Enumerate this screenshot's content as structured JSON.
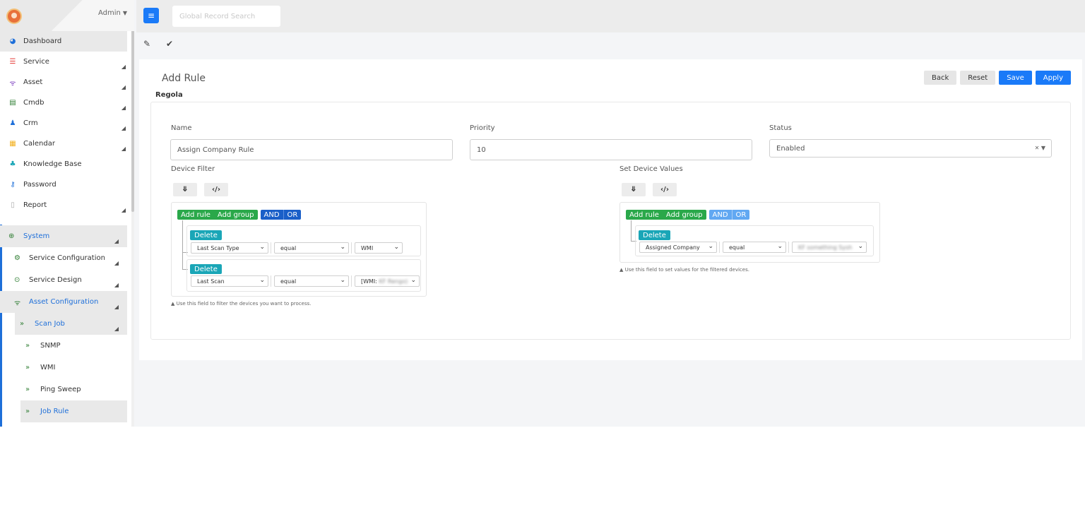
{
  "sidebar": {
    "user_label": "Admin",
    "items": [
      {
        "label": "Dashboard",
        "icon": "dashboard-icon",
        "color": "#1e6fd9"
      },
      {
        "label": "Service",
        "icon": "list-icon",
        "color": "#e53935"
      },
      {
        "label": "Asset",
        "icon": "wifi-icon",
        "color": "#7b3fbf"
      },
      {
        "label": "Cmdb",
        "icon": "database-icon",
        "color": "#2e7d32"
      },
      {
        "label": "Crm",
        "icon": "user-icon",
        "color": "#1e6fd9"
      },
      {
        "label": "Calendar",
        "icon": "calendar-icon",
        "color": "#f2b01e"
      },
      {
        "label": "Knowledge Base",
        "icon": "knowledge-icon",
        "color": "#1aa6b7"
      },
      {
        "label": "Password",
        "icon": "key-icon",
        "color": "#1e6fd9"
      },
      {
        "label": "Report",
        "icon": "file-icon",
        "color": "#999999"
      }
    ],
    "system": {
      "label": "System",
      "icon": "globe-icon",
      "color": "#2e7d32"
    },
    "system_children": [
      {
        "label": "Service Configuration",
        "icon": "cogs-icon",
        "color": "#2e7d32"
      },
      {
        "label": "Service Design",
        "icon": "target-icon",
        "color": "#2e7d32"
      },
      {
        "label": "Asset Configuration",
        "icon": "wifi-icon",
        "color": "#2e7d32"
      }
    ],
    "scan_job": {
      "label": "Scan Job"
    },
    "scan_children": [
      {
        "label": "SNMP"
      },
      {
        "label": "WMI"
      },
      {
        "label": "Ping Sweep"
      },
      {
        "label": "Job Rule"
      }
    ]
  },
  "topbar": {
    "menu_icon": "≡",
    "search_placeholder": "Global Record Search"
  },
  "page": {
    "title": "Add Rule",
    "subtitle": "Regola",
    "actions": {
      "back": "Back",
      "reset": "Reset",
      "save": "Save",
      "apply": "Apply"
    }
  },
  "form": {
    "name_label": "Name",
    "name_value": "Assign Company Rule",
    "priority_label": "Priority",
    "priority_value": "10",
    "status_label": "Status",
    "status_value": "Enabled",
    "device_filter_label": "Device Filter",
    "set_values_label": "Set Device Values"
  },
  "query_builder": {
    "add_rule": "Add rule",
    "add_group": "Add group",
    "and": "AND",
    "or": "OR",
    "delete": "Delete"
  },
  "filter_rules": [
    {
      "field": "Last Scan Type",
      "operator": "equal",
      "value": "WMI"
    },
    {
      "field": "Last Scan",
      "operator": "equal",
      "value": "[WMI:"
    }
  ],
  "value_rules": [
    {
      "field": "Assigned Company",
      "operator": "equal",
      "value": ""
    }
  ],
  "hints": {
    "filter": "Use this field to filter the devices you want to process.",
    "values": "Use this field to set values for the filtered devices."
  },
  "colors": {
    "primary": "#1a7af8",
    "green": "#2aa84a",
    "teal": "#1aa6b7",
    "navy": "#1a5fc8"
  }
}
